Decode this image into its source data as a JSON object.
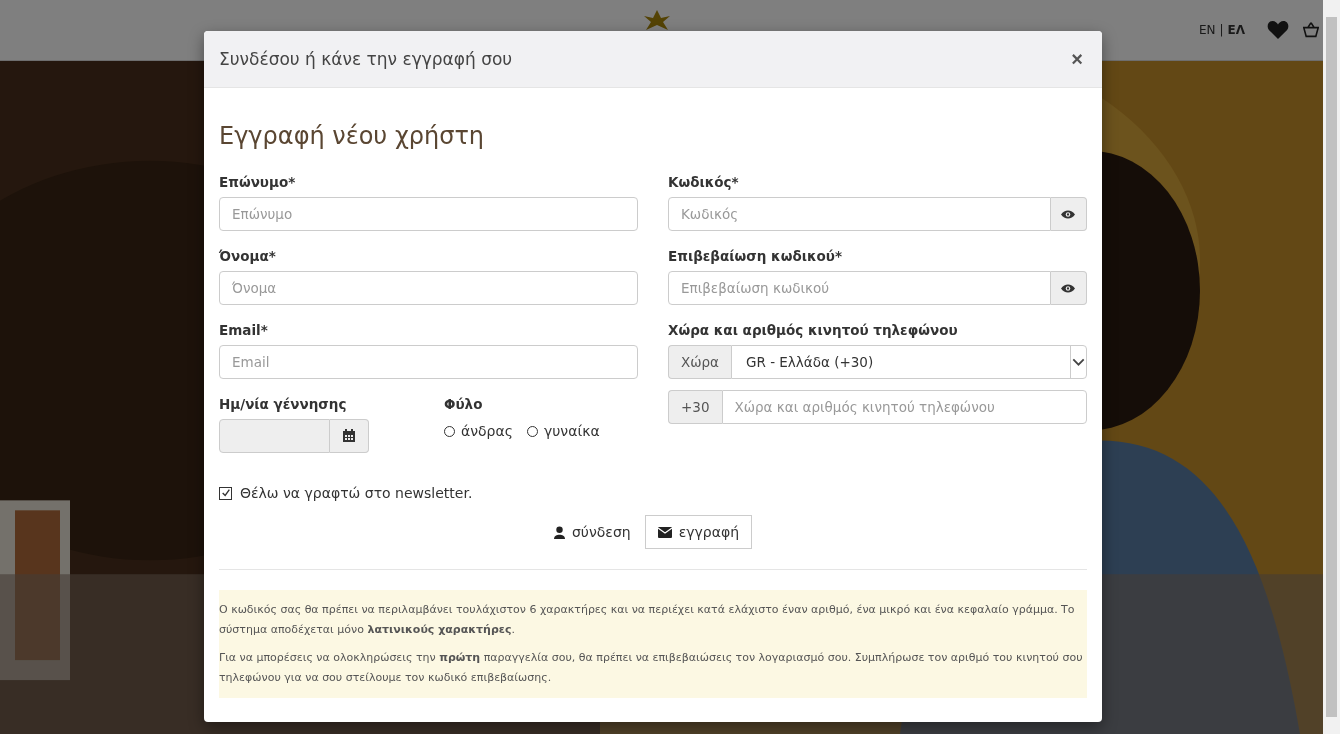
{
  "header": {
    "languages": [
      {
        "label": "EN",
        "selected": false
      },
      {
        "label": "ΕΛ",
        "selected": true
      }
    ],
    "language_separator": "|"
  },
  "modal": {
    "title": "Συνδέσου ή κάνε την εγγραφή σου",
    "close": "×",
    "heading": "Εγγραφή νέου χρήστη",
    "left_fields": [
      {
        "label": "Επώνυμο*",
        "placeholder": "Επώνυμο"
      },
      {
        "label": "Όνομα*",
        "placeholder": "Όνομα"
      },
      {
        "label": "Email*",
        "placeholder": "Email"
      }
    ],
    "password_fields": [
      {
        "label": "Κωδικός*",
        "placeholder": "Κωδικός"
      },
      {
        "label": "Επιβεβαίωση κωδικού*",
        "placeholder": "Επιβεβαίωση κωδικού"
      }
    ],
    "phone": {
      "label": "Χώρα και αριθμός κινητού τηλεφώνου",
      "country_addon": "Χώρα",
      "country_value": "GR - Ελλάδα (+30)",
      "prefix": "+30",
      "placeholder": "Χώρα και αριθμός κινητού τηλεφώνου"
    },
    "birthdate": {
      "label": "Ημ/νία γέννησης",
      "disabled": true
    },
    "gender": {
      "label": "Φύλο",
      "options": [
        {
          "label": "άνδρας",
          "selected": false
        },
        {
          "label": "γυναίκα",
          "selected": false
        }
      ]
    },
    "newsletter": {
      "label": "Θέλω να γραφτώ στο newsletter.",
      "checked": true
    },
    "actions": [
      {
        "label": "σύνδεση",
        "kind": "link"
      },
      {
        "label": "εγγραφή",
        "kind": "button"
      }
    ],
    "notes": [
      "Ο κωδικός σας θα πρέπει να περιλαμβάνει τουλάχιστον 6 χαρακτήρες και να περιέχει κατά ελάχιστο έναν αριθμό, ένα μικρό και ένα κεφαλαίο γράμμα. Το σύστημα αποδέχεται μόνο **λατινικούς χαρακτήρες**.",
      "Για να μπορέσεις να ολοκληρώσεις την **πρώτη** παραγγελία σου, θα πρέπει να επιβεβαιώσεις τον λογαριασμό σου. Συμπλήρωσε τον αριθμό του κινητού σου τηλεφώνου για να σου στείλουμε τον κωδικό επιβεβαίωσης."
    ]
  }
}
